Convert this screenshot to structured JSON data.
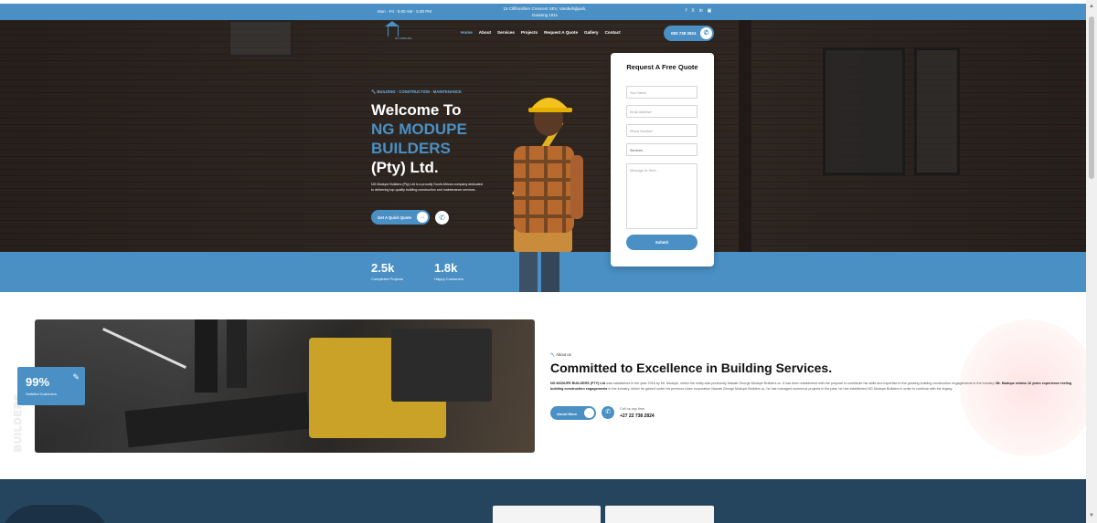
{
  "topbar": {
    "hours": "Mon - Fri : 8.00 AM - 5.00 PM",
    "address_line1": "15 Cliffsmithier Crescent SEV, Vanderbijlpark,",
    "address_line2": "Gauteng 1911",
    "social": [
      "f",
      "X",
      "in",
      "ig"
    ]
  },
  "nav": {
    "logo_text": "NG MODUPE",
    "items": [
      "Home",
      "About",
      "Services",
      "Projects",
      "Request A Quote",
      "Gallery",
      "Contact"
    ],
    "phone": "083 738 2824"
  },
  "hero": {
    "tagline": "BUILDING - CONSTRUCTION - MAINTENANCE",
    "title_line1": "Welcome To",
    "title_line2": "NG MODUPE",
    "title_line3": "BUILDERS",
    "title_line4": "(Pty) Ltd.",
    "description": "NG Modupe Builders (Pty) Ltd is a proudly South African company dedicated to delivering top-quality building construction and maintenance services.",
    "cta": "Get A Quick Quote"
  },
  "stats": [
    {
      "value": "2.5k",
      "label": "Completed Projects"
    },
    {
      "value": "1.8k",
      "label": "Happy Customers"
    }
  ],
  "quote_form": {
    "title": "Request A Free Quote",
    "name_placeholder": "Your Name",
    "email_placeholder": "Email Address*",
    "phone_placeholder": "Phone Number*",
    "services_label": "Services",
    "message_placeholder": "Message Or Here...",
    "submit": "Submit"
  },
  "about": {
    "side_text": "BUILDERS",
    "badge_value": "99%",
    "badge_label": "Satisfied Customers",
    "tag": "About us",
    "title": "Committed to Excellence in Building Services.",
    "body_lead": "NG MODUPE BUILDERS (PTY) Ltd",
    "body_1": " was established in the year 2016 by Mr. Modupe, which the entity was previously Nawab George Modupe Builders cc. It has been established with the purpose to contribute his skills and expertise to the growing building construction engagements in the industry. ",
    "body_bold": "Mr. Modupe retains 16 years experience reeling building construction engagements",
    "body_2": " in the industry, which he gained under his previous close corporation Nawab George Modupe Builders cc, he has managed numerous projects in the past, he has established NG Modupe Builders in order to continue with the legacy.",
    "more": "About More",
    "call_label": "Call us any time",
    "call_number": "+27 22 738 2824"
  }
}
